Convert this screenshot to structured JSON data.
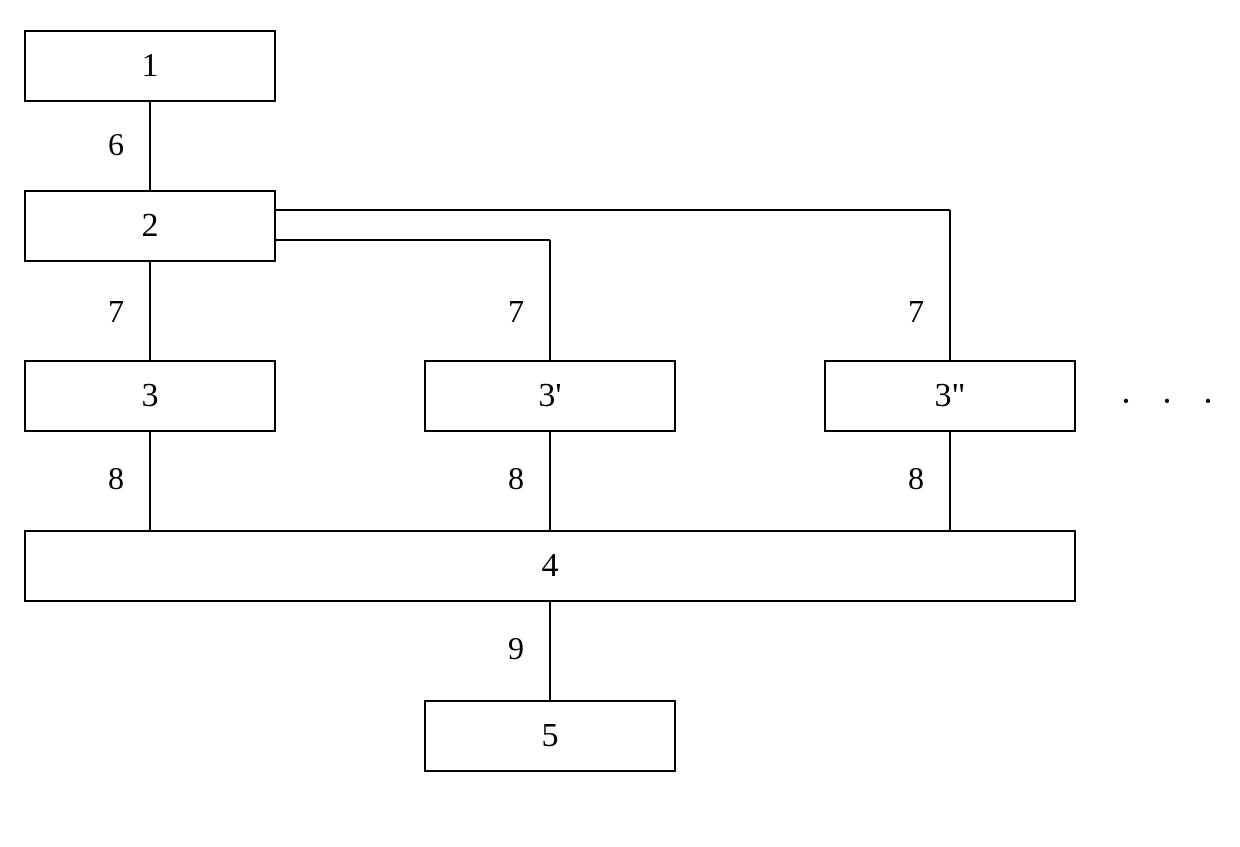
{
  "chart_data": {
    "type": "diagram",
    "nodes": [
      {
        "id": "n1",
        "label": "1"
      },
      {
        "id": "n2",
        "label": "2"
      },
      {
        "id": "n3",
        "label": "3"
      },
      {
        "id": "n3p",
        "label": "3'"
      },
      {
        "id": "n3pp",
        "label": "3\""
      },
      {
        "id": "n4",
        "label": "4"
      },
      {
        "id": "n5",
        "label": "5"
      }
    ],
    "edges": [
      {
        "from": "n1",
        "to": "n2",
        "label": "6"
      },
      {
        "from": "n2",
        "to": "n3",
        "label": "7"
      },
      {
        "from": "n2",
        "to": "n3p",
        "label": "7"
      },
      {
        "from": "n2",
        "to": "n3pp",
        "label": "7"
      },
      {
        "from": "n3",
        "to": "n4",
        "label": "8"
      },
      {
        "from": "n3p",
        "to": "n4",
        "label": "8"
      },
      {
        "from": "n3pp",
        "to": "n4",
        "label": "8"
      },
      {
        "from": "n4",
        "to": "n5",
        "label": "9"
      }
    ],
    "ellipsis": "· · ·"
  },
  "boxes": {
    "b1": "1",
    "b2": "2",
    "b3": "3",
    "b3p": "3'",
    "b3pp": "3\"",
    "b4": "4",
    "b5": "5"
  },
  "edge_labels": {
    "e6": "6",
    "e7a": "7",
    "e7b": "7",
    "e7c": "7",
    "e8a": "8",
    "e8b": "8",
    "e8c": "8",
    "e9": "9"
  },
  "ellipsis": "· · ·"
}
